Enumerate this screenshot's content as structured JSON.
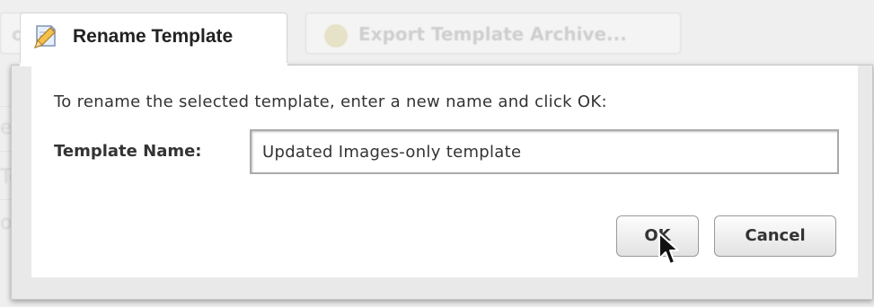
{
  "background": {
    "left_button_fragment": "o",
    "export_button_label": "Export Template Archive...",
    "row_fragments": [
      "e",
      "Te",
      "o"
    ]
  },
  "dialog": {
    "title": "Rename Template",
    "instruction": "To rename the selected template, enter a new name and click OK:",
    "field_label": "Template Name:",
    "template_name_value": "Updated Images-only template",
    "ok_label": "OK",
    "cancel_label": "Cancel"
  },
  "icons": {
    "title_icon": "edit-document-icon",
    "export_icon": "archive-icon",
    "cursor": "mouse-pointer-icon"
  }
}
